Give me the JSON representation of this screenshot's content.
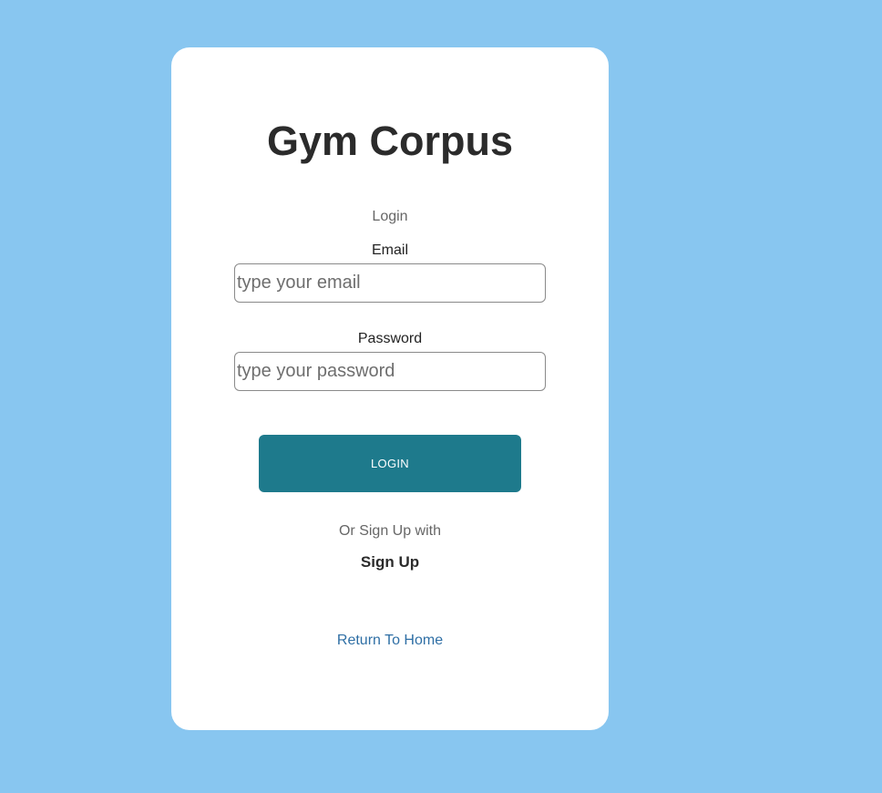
{
  "app": {
    "title": "Gym Corpus",
    "subtitle": "Login"
  },
  "form": {
    "email": {
      "label": "Email",
      "placeholder": "type your email",
      "value": ""
    },
    "password": {
      "label": "Password",
      "placeholder": "type your password",
      "value": ""
    },
    "login_label": "LOGIN"
  },
  "signup": {
    "prompt": "Or Sign Up with",
    "link_label": "Sign Up"
  },
  "footer": {
    "home_link_label": "Return To Home"
  },
  "colors": {
    "background": "#88c6f0",
    "card": "#ffffff",
    "button": "#1e7a8c",
    "link": "#2f6fa5"
  }
}
